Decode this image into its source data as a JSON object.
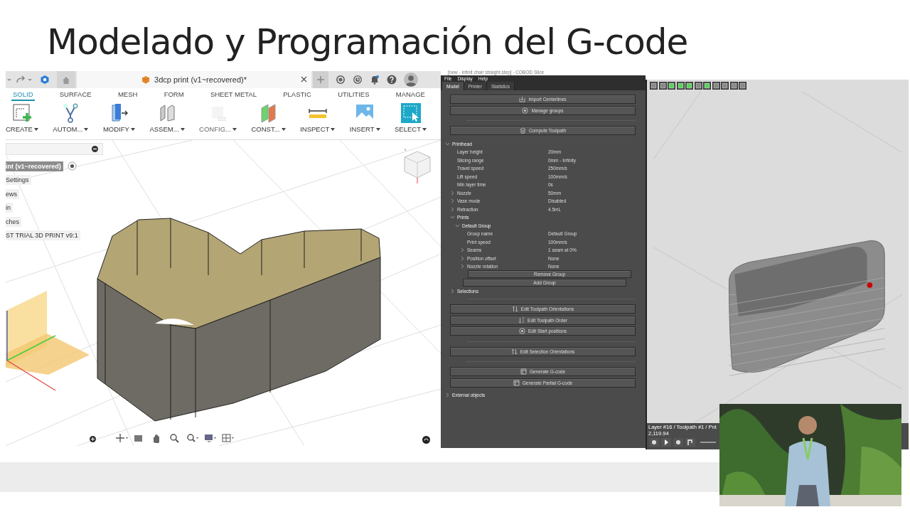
{
  "slide_title": "Modelado y Programación del G-code",
  "fusion": {
    "document_tab": "3dcp print (v1~recovered)*",
    "ribbon_tabs": [
      {
        "label": "SOLID",
        "selected": true
      },
      {
        "label": "SURFACE",
        "selected": false
      },
      {
        "label": "MESH",
        "selected": false
      },
      {
        "label": "FORM",
        "selected": false
      },
      {
        "label": "SHEET METAL",
        "selected": false
      },
      {
        "label": "PLASTIC",
        "selected": false
      },
      {
        "label": "UTILITIES",
        "selected": false
      },
      {
        "label": "MANAGE",
        "selected": false
      }
    ],
    "tools": [
      {
        "kind": "create",
        "label": "CREATE",
        "disabled": false
      },
      {
        "kind": "automate",
        "label": "AUTOM...",
        "disabled": false
      },
      {
        "kind": "modify",
        "label": "MODIFY",
        "disabled": false
      },
      {
        "kind": "assemble",
        "label": "ASSEM...",
        "disabled": false
      },
      {
        "kind": "configure",
        "label": "CONFIG...",
        "disabled": true
      },
      {
        "kind": "construct",
        "label": "CONST...",
        "disabled": false
      },
      {
        "kind": "inspect",
        "label": "INSPECT",
        "disabled": false
      },
      {
        "kind": "insert",
        "label": "INSERT",
        "disabled": false
      },
      {
        "kind": "select",
        "label": "SELECT",
        "disabled": false
      }
    ],
    "browser_items": [
      {
        "label": "int (v1~recovered)",
        "selected": true
      },
      {
        "label": "Settings",
        "selected": false
      },
      {
        "label": "ews",
        "selected": false
      },
      {
        "label": "in",
        "selected": false
      },
      {
        "label": "ches",
        "selected": false
      },
      {
        "label": "ST TRIAL 3D PRINT v9:1",
        "selected": false
      }
    ]
  },
  "slicer": {
    "title": "[new - infinit chair straight.step] - COBOD Slice",
    "menu": [
      "File",
      "Display",
      "Help"
    ],
    "tabs": [
      {
        "label": "Model",
        "selected": true
      },
      {
        "label": "Printer",
        "selected": false
      },
      {
        "label": "Statistics",
        "selected": false
      }
    ],
    "top_buttons": [
      {
        "kind": "import",
        "label": "Import Centerlines"
      },
      {
        "kind": "groups",
        "label": "Manage groups"
      }
    ],
    "compute_button": "Compute Toolpath",
    "tree": [
      {
        "kind": "group",
        "label": "Printhead",
        "expanded": true,
        "children": [
          {
            "kind": "property",
            "label": "Layer height",
            "value": "20mm"
          },
          {
            "kind": "property",
            "label": "Slicing range",
            "value": "0mm - Infinity"
          },
          {
            "kind": "property",
            "label": "Travel speed",
            "value": "250mm/s"
          },
          {
            "kind": "property",
            "label": "Lift speed",
            "value": "100mm/s"
          },
          {
            "kind": "property",
            "label": "Min layer time",
            "value": "0s"
          },
          {
            "kind": "property",
            "label": "Nozzle",
            "value": "50mm",
            "expanded": false
          },
          {
            "kind": "property",
            "label": "Vase mode",
            "value": "Disabled",
            "expanded": false
          },
          {
            "kind": "property",
            "label": "Retraction",
            "value": "4.5mL",
            "expanded": false
          },
          {
            "kind": "group",
            "label": "Prints",
            "expanded": true,
            "children": [
              {
                "kind": "group",
                "label": "Default Group",
                "expanded": true,
                "children": [
                  {
                    "kind": "property",
                    "label": "Group name",
                    "value": "Default Group"
                  },
                  {
                    "kind": "property",
                    "label": "Print speed",
                    "value": "100mm/s"
                  },
                  {
                    "kind": "property",
                    "label": "Seams",
                    "value": "1 seam at 0%",
                    "expanded": false
                  },
                  {
                    "kind": "property",
                    "label": "Position offset",
                    "value": "None",
                    "expanded": false
                  },
                  {
                    "kind": "property",
                    "label": "Nozzle rotation",
                    "value": "None",
                    "expanded": false
                  },
                  {
                    "kind": "button",
                    "label": "Remove Group"
                  }
                ]
              },
              {
                "kind": "button",
                "label": "Add Group"
              }
            ]
          },
          {
            "kind": "group",
            "label": "Selections",
            "expanded": false
          }
        ]
      }
    ],
    "action_groups": [
      [
        {
          "kind": "orient",
          "label": "Edit Toolpath Orientations"
        },
        {
          "kind": "order",
          "label": "Edit Toolpath Order"
        },
        {
          "kind": "start",
          "label": "Edit Start positions"
        }
      ],
      [
        {
          "kind": "orient",
          "label": "Edit Selection Orientations"
        }
      ],
      [
        {
          "kind": "gcode",
          "label": "Generate G-code"
        },
        {
          "kind": "gcode",
          "label": "Generate Partial G-code"
        }
      ]
    ],
    "footer_tree": [
      {
        "kind": "group",
        "label": "External objects",
        "expanded": false
      }
    ],
    "view_tools": [
      {
        "on": false
      },
      {
        "on": false
      },
      {
        "on": true
      },
      {
        "on": true
      },
      {
        "on": true
      },
      {
        "on": false
      },
      {
        "on": true
      },
      {
        "on": false
      },
      {
        "on": false
      },
      {
        "on": false
      },
      {
        "on": false
      }
    ],
    "status": "Layer #16 / Toolpath #1 / Pnt 2,119.94"
  }
}
